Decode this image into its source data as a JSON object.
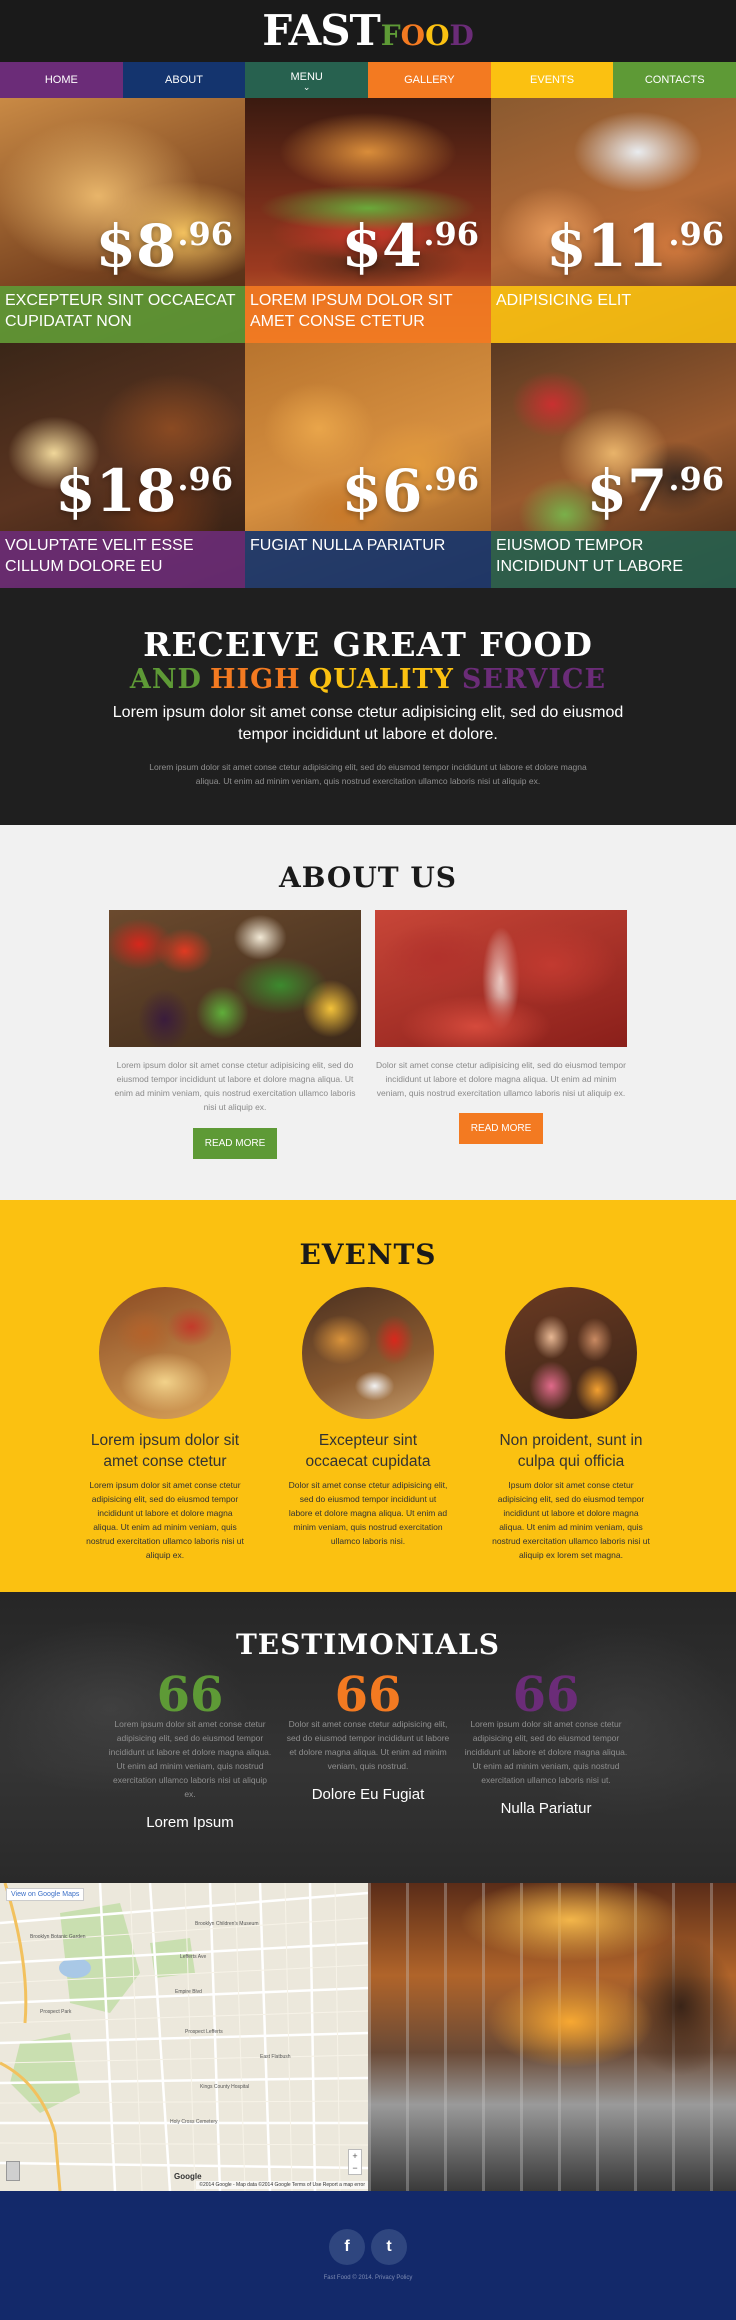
{
  "colors": {
    "purple": "#6b2c78",
    "navy": "#14346e",
    "teal": "#27614f",
    "orange": "#f37a21",
    "yellow": "#fbc111",
    "green": "#5e9a36",
    "dark": "#1f1f1f",
    "footer": "#13296a"
  },
  "header": {
    "logo_fast": "FAST",
    "logo_food": [
      "F",
      "O",
      "O",
      "D"
    ]
  },
  "nav": {
    "items": [
      {
        "label": "HOME"
      },
      {
        "label": "ABOUT"
      },
      {
        "label": "MENU",
        "icon": "chevron-down-icon"
      },
      {
        "label": "GALLERY"
      },
      {
        "label": "EVENTS"
      },
      {
        "label": "CONTACTS"
      }
    ]
  },
  "products": [
    {
      "price": "$8",
      "cents": ".96",
      "caption": "EXCEPTEUR SINT OCCAECAT CUPIDATAT NON"
    },
    {
      "price": "$4",
      "cents": ".96",
      "caption": "LOREM IPSUM DOLOR SIT AMET CONSE CTETUR"
    },
    {
      "price": "$11",
      "cents": ".96",
      "caption": "ADIPISICING ELIT"
    },
    {
      "price": "$18",
      "cents": ".96",
      "caption": "VOLUPTATE VELIT ESSE CILLUM DOLORE EU"
    },
    {
      "price": "$6",
      "cents": ".96",
      "caption": "FUGIAT NULLA PARIATUR"
    },
    {
      "price": "$7",
      "cents": ".96",
      "caption": "EIUSMOD TEMPOR INCIDIDUNT UT LABORE"
    }
  ],
  "receive": {
    "title": "RECEIVE GREAT FOOD",
    "subtitle_words": [
      "AND",
      "HIGH",
      "QUALITY",
      "SERVICE"
    ],
    "lead": "Lorem ipsum dolor sit amet conse ctetur adipisicing elit, sed do eiusmod tempor incididunt ut labore et dolore.",
    "small": "Lorem ipsum dolor sit amet conse ctetur adipisicing elit, sed do eiusmod tempor incididunt ut labore et dolore magna aliqua. Ut enim ad minim veniam, quis nostrud exercitation ullamco laboris nisi ut aliquip ex."
  },
  "about": {
    "title": "ABOUT US",
    "columns": [
      {
        "text": "Lorem ipsum dolor sit amet conse ctetur adipisicing elit, sed do eiusmod tempor incididunt ut labore et dolore magna aliqua. Ut enim ad minim veniam, quis nostrud exercitation ullamco laboris nisi ut aliquip ex.",
        "button": "READ MORE"
      },
      {
        "text": "Dolor sit amet conse ctetur adipisicing elit, sed do eiusmod tempor incididunt ut labore et dolore magna aliqua. Ut enim ad minim veniam, quis nostrud exercitation ullamco laboris nisi ut aliquip ex.",
        "button": "READ MORE"
      }
    ]
  },
  "events": {
    "title": "EVENTS",
    "items": [
      {
        "title": "Lorem ipsum dolor sit amet conse ctetur",
        "text": "Lorem ipsum dolor sit amet conse ctetur adipisicing elit, sed do eiusmod tempor incididunt ut labore et dolore magna aliqua. Ut enim ad minim veniam, quis nostrud exercitation ullamco laboris nisi ut aliquip ex."
      },
      {
        "title": "Excepteur sint occaecat cupidata",
        "text": "Dolor sit amet conse ctetur adipisicing elit, sed do eiusmod tempor incididunt ut labore et dolore magna aliqua. Ut enim ad minim veniam, quis nostrud exercitation ullamco laboris nisi."
      },
      {
        "title": "Non proident, sunt in culpa qui officia",
        "text": "Ipsum dolor sit amet conse ctetur adipisicing elit, sed do eiusmod tempor incididunt ut labore et dolore magna aliqua. Ut enim ad minim veniam, quis nostrud exercitation ullamco laboris nisi ut aliquip ex lorem set magna."
      }
    ]
  },
  "testimonials": {
    "title": "TESTIMONIALS",
    "items": [
      {
        "quote_mark": "66",
        "text": "Lorem ipsum dolor sit amet conse ctetur adipisicing elit, sed do eiusmod tempor incididunt ut labore et dolore magna aliqua. Ut enim ad minim veniam, quis nostrud exercitation ullamco laboris nisi ut aliquip ex.",
        "author": "Lorem Ipsum"
      },
      {
        "quote_mark": "66",
        "text": "Dolor sit amet conse ctetur adipisicing elit, sed do eiusmod tempor incididunt ut labore et dolore magna aliqua. Ut enim ad minim veniam, quis nostrud.",
        "author": "Dolore Eu Fugiat"
      },
      {
        "quote_mark": "66",
        "text": "Lorem ipsum dolor sit amet conse ctetur adipisicing elit, sed do eiusmod tempor incididunt ut labore et dolore magna aliqua. Ut enim ad minim veniam, quis nostrud exercitation ullamco laboris nisi ut.",
        "author": "Nulla Pariatur"
      }
    ]
  },
  "map": {
    "view_link": "View on Google Maps",
    "google": "Google",
    "copyright": "©2014 Google - Map data ©2014 Google  Terms of Use  Report a map error",
    "zoom_in": "+",
    "zoom_out": "−"
  },
  "footer": {
    "socials": [
      {
        "label": "f",
        "icon": "facebook-icon"
      },
      {
        "label": "t",
        "icon": "twitter-icon"
      }
    ],
    "copyright": "Fast Food © 2014. Privacy Policy"
  }
}
